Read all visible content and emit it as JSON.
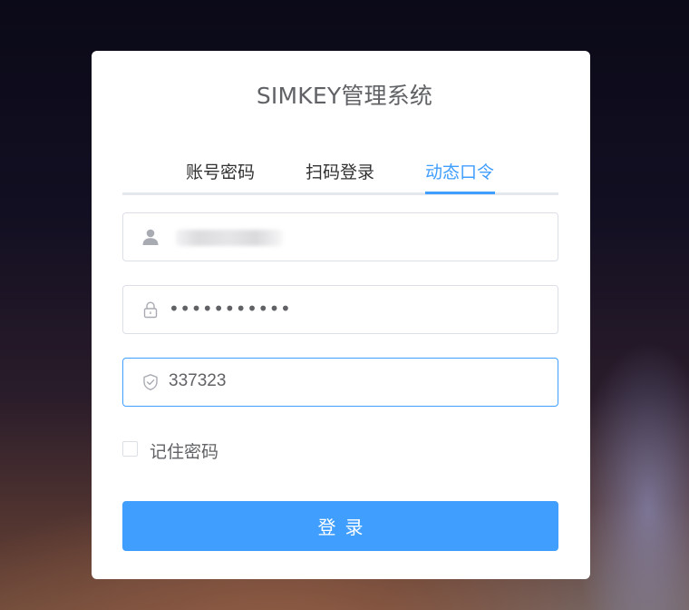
{
  "app": {
    "title": "SIMKEY管理系统"
  },
  "tabs": [
    {
      "label": "账号密码",
      "active": false
    },
    {
      "label": "扫码登录",
      "active": false
    },
    {
      "label": "动态口令",
      "active": true
    }
  ],
  "form": {
    "username": {
      "icon": "user-icon",
      "value": ""
    },
    "password": {
      "icon": "lock-icon",
      "value": "•••••••••••"
    },
    "otp": {
      "icon": "shield-check-icon",
      "value": "337323",
      "focused": true
    },
    "remember": {
      "label": "记住密码",
      "checked": false
    },
    "submit_label": "登录"
  },
  "colors": {
    "accent": "#409eff",
    "border": "#dcdfe6",
    "text": "#606266",
    "title": "#606266"
  }
}
